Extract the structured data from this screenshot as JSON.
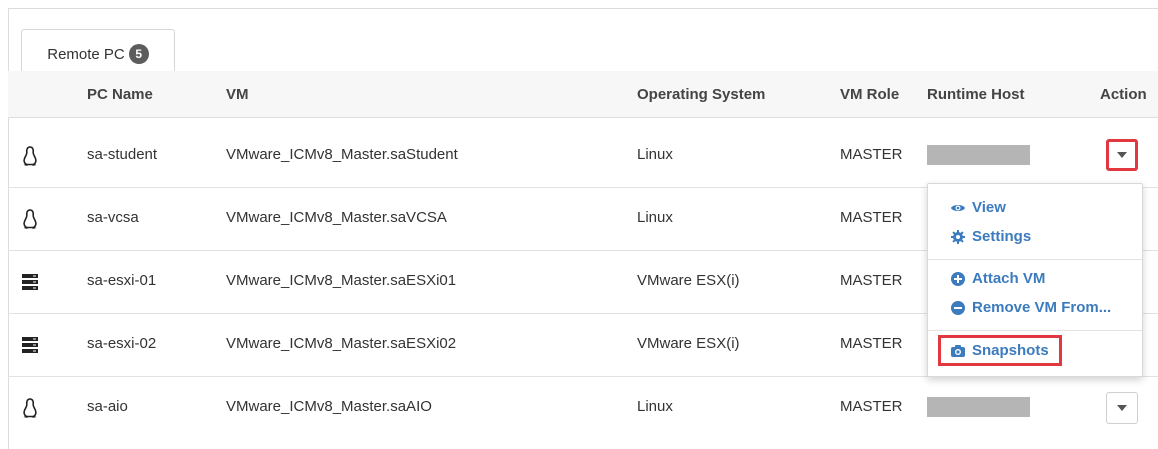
{
  "tab": {
    "label": "Remote PC",
    "count": "5"
  },
  "columns": {
    "pc_name": "PC Name",
    "vm": "VM",
    "os": "Operating System",
    "role": "VM Role",
    "host": "Runtime Host",
    "action": "Action"
  },
  "rows": [
    {
      "icon": "linux-icon",
      "pc_name": "sa-student",
      "vm": "VMware_ICMv8_Master.saStudent",
      "os": "Linux",
      "role": "MASTER"
    },
    {
      "icon": "linux-icon",
      "pc_name": "sa-vcsa",
      "vm": "VMware_ICMv8_Master.saVCSA",
      "os": "Linux",
      "role": "MASTER"
    },
    {
      "icon": "server-icon",
      "pc_name": "sa-esxi-01",
      "vm": "VMware_ICMv8_Master.saESXi01",
      "os": "VMware ESX(i)",
      "role": "MASTER"
    },
    {
      "icon": "server-icon",
      "pc_name": "sa-esxi-02",
      "vm": "VMware_ICMv8_Master.saESXi02",
      "os": "VMware ESX(i)",
      "role": "MASTER"
    },
    {
      "icon": "linux-icon",
      "pc_name": "sa-aio",
      "vm": "VMware_ICMv8_Master.saAIO",
      "os": "Linux",
      "role": "MASTER"
    }
  ],
  "menu": {
    "view": "View",
    "settings": "Settings",
    "attach_vm": "Attach VM",
    "remove_vm": "Remove VM From...",
    "snapshots": "Snapshots"
  },
  "colors": {
    "link": "#3c7bbd",
    "highlight": "#e0383e",
    "redacted": "#b5b5b5"
  }
}
